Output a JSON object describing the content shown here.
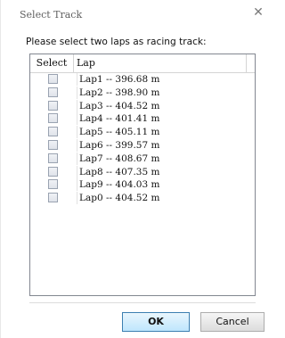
{
  "window": {
    "title": "Select Track"
  },
  "prompt": "Please select two laps as racing track:",
  "table": {
    "headers": {
      "select": "Select",
      "lap": "Lap"
    },
    "rows": [
      {
        "label": "Lap1  -- 396.68 m",
        "checked": false
      },
      {
        "label": "Lap2  -- 398.90 m",
        "checked": false
      },
      {
        "label": "Lap3  -- 404.52 m",
        "checked": false
      },
      {
        "label": "Lap4  -- 401.41 m",
        "checked": false
      },
      {
        "label": "Lap5  -- 405.11 m",
        "checked": false
      },
      {
        "label": "Lap6  -- 399.57 m",
        "checked": false
      },
      {
        "label": "Lap7  -- 408.67 m",
        "checked": false
      },
      {
        "label": "Lap8  -- 407.35 m",
        "checked": false
      },
      {
        "label": "Lap9  -- 404.03 m",
        "checked": false
      },
      {
        "label": "Lap0  -- 404.52 m",
        "checked": false
      }
    ]
  },
  "buttons": {
    "ok": "OK",
    "cancel": "Cancel"
  },
  "icons": {
    "close": "close-icon",
    "checkbox": "checkbox-icon"
  }
}
